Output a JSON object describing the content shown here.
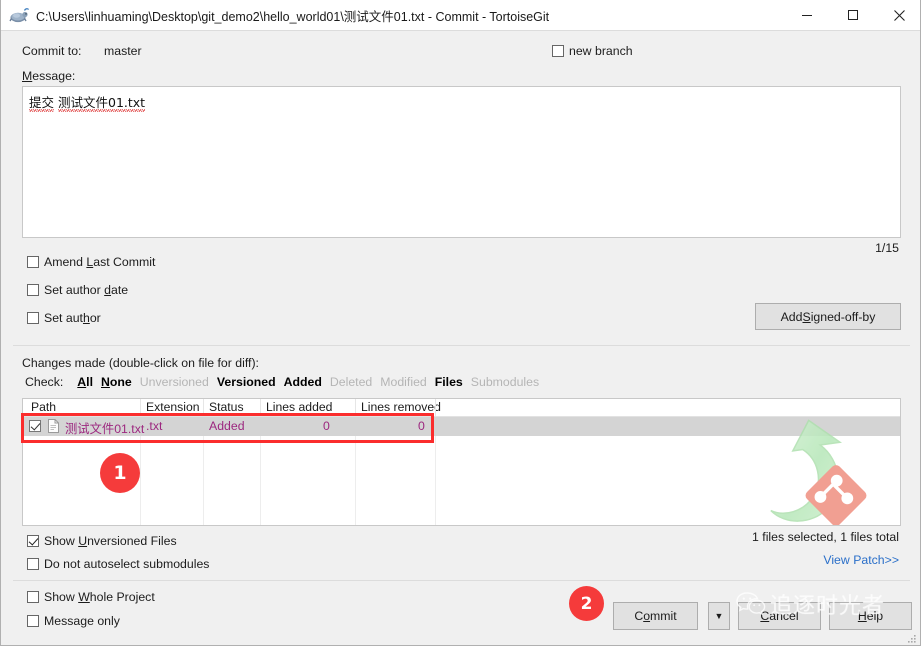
{
  "window": {
    "title": "C:\\Users\\linhuaming\\Desktop\\git_demo2\\hello_world01\\测试文件01.txt - Commit - TortoiseGit",
    "icon": "tortoisegit-icon",
    "minimize": "—",
    "maximize": "☐",
    "close": "✕"
  },
  "commit_to": {
    "label": "Commit to:",
    "branch": "master",
    "new_branch_label": "new branch",
    "new_branch_checked": false
  },
  "message": {
    "label": "Message:",
    "prefix": "提交",
    "filename": "测试文件01.txt",
    "counter": "1/15"
  },
  "options": {
    "amend_last_commit": "Amend Last Commit",
    "set_author_date": "Set author date",
    "set_author": "Set author",
    "add_signed_off_by": "Add Signed-off-by"
  },
  "changes": {
    "title": "Changes made (double-click on file for diff):",
    "check_label": "Check:",
    "filters": [
      {
        "label": "All",
        "enabled": true
      },
      {
        "label": "None",
        "enabled": true
      },
      {
        "label": "Unversioned",
        "enabled": false
      },
      {
        "label": "Versioned",
        "enabled": true
      },
      {
        "label": "Added",
        "enabled": true
      },
      {
        "label": "Deleted",
        "enabled": false
      },
      {
        "label": "Modified",
        "enabled": false
      },
      {
        "label": "Files",
        "enabled": true
      },
      {
        "label": "Submodules",
        "enabled": false
      }
    ],
    "columns": [
      "Path",
      "Extension",
      "Status",
      "Lines added",
      "Lines removed"
    ],
    "rows": [
      {
        "checked": true,
        "path": "测试文件01.txt",
        "extension": ".txt",
        "status": "Added",
        "lines_added": "0",
        "lines_removed": "0"
      }
    ],
    "status_text": "1 files selected, 1 files total",
    "view_patch": "View Patch>>"
  },
  "bottom_options": {
    "show_unversioned_files": "Show Unversioned Files",
    "show_unversioned_checked": true,
    "do_not_autoselect_submodules": "Do not autoselect submodules",
    "show_whole_project": "Show Whole Project",
    "message_only": "Message only"
  },
  "buttons": {
    "commit": "Commit",
    "commit_dropdown": "▼",
    "cancel": "Cancel",
    "help": "Help"
  },
  "annotations": {
    "badge_one": "1",
    "badge_two": "2"
  },
  "watermark": {
    "text": "追逐时光者",
    "logo": "wechat-icon"
  },
  "colors": {
    "accent_red": "#fb2d2d",
    "link_blue": "#2a6fc9",
    "row_text": "#9c277f",
    "window_bg": "#f0f0f0"
  }
}
